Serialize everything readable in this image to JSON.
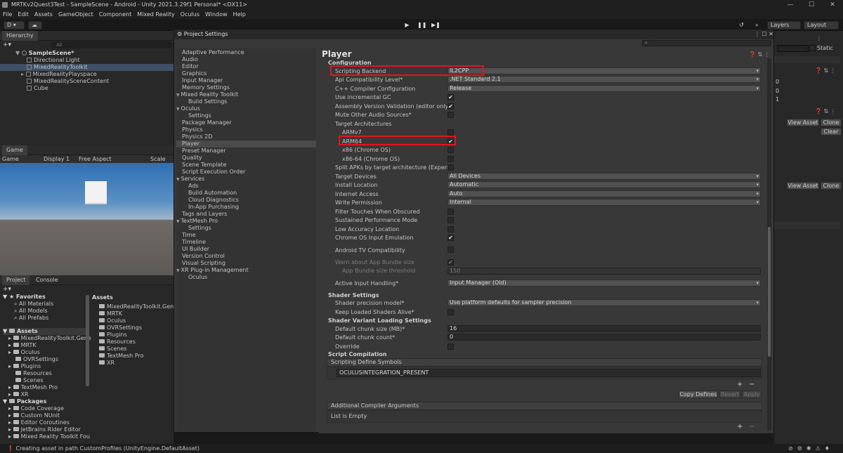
{
  "window": {
    "title": "MRTKv2Quest3Test - SampleScene - Android - Unity 2021.3.29f1 Personal* <DX11>",
    "controls": [
      "—",
      "☐",
      "✕"
    ]
  },
  "menu": [
    "File",
    "Edit",
    "Assets",
    "GameObject",
    "Component",
    "Mixed Reality",
    "Oculus",
    "Window",
    "Help"
  ],
  "toolbar": {
    "account": "D ▾",
    "cloud": "☁",
    "layers": "Layers",
    "layout": "Layout",
    "play": "▶",
    "pause": "❚❚",
    "step": "▶❚"
  },
  "hierarchy": {
    "tab": "Hierarchy",
    "search_placeholder": "All",
    "scene": "SampleScene*",
    "items": [
      "Directional Light",
      "MixedRealityToolkit",
      "MixedRealityPlayspace",
      "MixedRealitySceneContent",
      "Cube"
    ]
  },
  "game": {
    "tab": "Game",
    "mode": "Game",
    "display": "Display 1",
    "aspect": "Free Aspect",
    "scale": "Scale"
  },
  "project": {
    "tabs": [
      "Project",
      "Console"
    ],
    "favorites_label": "Favorites",
    "favorites": [
      "All Materials",
      "All Models",
      "All Prefabs"
    ],
    "assets_label": "Assets",
    "assets_tree": [
      "MixedRealityToolkit.Gene",
      "MRTK",
      "Oculus",
      "OVRSettings",
      "Plugins",
      "Resources",
      "Scenes",
      "TextMesh Pro",
      "XR"
    ],
    "packages_label": "Packages",
    "packages": [
      "Code Coverage",
      "Custom NUnit",
      "Editor Coroutines",
      "JetBrains Rider Editor",
      "Mixed Reality Toolkit Fou",
      "Mixed Reality Toolkit Fo"
    ],
    "assets_header": "Assets",
    "assets_list": [
      "MixedRealityToolkit.Genera",
      "MRTK",
      "Oculus",
      "OVRSettings",
      "Plugins",
      "Resources",
      "Scenes",
      "TextMesh Pro",
      "XR"
    ]
  },
  "project_settings": {
    "title": "Project Settings",
    "categories": [
      {
        "label": "Adaptive Performance",
        "indent": 0
      },
      {
        "label": "Audio",
        "indent": 0
      },
      {
        "label": "Editor",
        "indent": 0
      },
      {
        "label": "Graphics",
        "indent": 0
      },
      {
        "label": "Input Manager",
        "indent": 0
      },
      {
        "label": "Memory Settings",
        "indent": 0
      },
      {
        "label": "Mixed Reality Toolkit",
        "indent": 0,
        "fold": "▼"
      },
      {
        "label": "Build Settings",
        "indent": 1
      },
      {
        "label": "Oculus",
        "indent": 0,
        "fold": "▼"
      },
      {
        "label": "Settings",
        "indent": 1
      },
      {
        "label": "Package Manager",
        "indent": 0
      },
      {
        "label": "Physics",
        "indent": 0
      },
      {
        "label": "Physics 2D",
        "indent": 0
      },
      {
        "label": "Player",
        "indent": 0,
        "selected": true
      },
      {
        "label": "Preset Manager",
        "indent": 0
      },
      {
        "label": "Quality",
        "indent": 0
      },
      {
        "label": "Scene Template",
        "indent": 0
      },
      {
        "label": "Script Execution Order",
        "indent": 0
      },
      {
        "label": "Services",
        "indent": 0,
        "fold": "▼"
      },
      {
        "label": "Ads",
        "indent": 1
      },
      {
        "label": "Build Automation",
        "indent": 1
      },
      {
        "label": "Cloud Diagnostics",
        "indent": 1
      },
      {
        "label": "In-App Purchasing",
        "indent": 1
      },
      {
        "label": "Tags and Layers",
        "indent": 0
      },
      {
        "label": "TextMesh Pro",
        "indent": 0,
        "fold": "▼"
      },
      {
        "label": "Settings",
        "indent": 1
      },
      {
        "label": "Time",
        "indent": 0
      },
      {
        "label": "Timeline",
        "indent": 0
      },
      {
        "label": "UI Builder",
        "indent": 0
      },
      {
        "label": "Version Control",
        "indent": 0
      },
      {
        "label": "Visual Scripting",
        "indent": 0
      },
      {
        "label": "XR Plug-in Management",
        "indent": 0,
        "fold": "▼"
      },
      {
        "label": "Oculus",
        "indent": 1
      }
    ],
    "player": {
      "heading": "Player",
      "configuration": "Configuration",
      "scripting_backend": {
        "label": "Scripting Backend",
        "value": "IL2CPP"
      },
      "api_level": {
        "label": "Api Compatibility Level*",
        "value": ".NET Standard 2.1"
      },
      "cpp_config": {
        "label": "C++ Compiler Configuration",
        "value": "Release"
      },
      "incremental_gc": {
        "label": "Use incremental GC",
        "checked": "✔"
      },
      "assembly_validation": {
        "label": "Assembly Version Validation (editor only)",
        "checked": "✔"
      },
      "mute_audio": {
        "label": "Mute Other Audio Sources*",
        "checked": ""
      },
      "target_arch": "Target Architectures",
      "armv7": {
        "label": "ARMv7",
        "checked": ""
      },
      "arm64": {
        "label": "ARM64",
        "checked": "✔"
      },
      "x86": {
        "label": "x86 (Chrome OS)",
        "checked": ""
      },
      "x86_64": {
        "label": "x86-64 (Chrome OS)",
        "checked": ""
      },
      "split_apks": {
        "label": "Split APKs by target architecture (Experimenta",
        "checked": ""
      },
      "target_devices": {
        "label": "Target Devices",
        "value": "All Devices"
      },
      "install_location": {
        "label": "Install Location",
        "value": "Automatic"
      },
      "internet_access": {
        "label": "Internet Access",
        "value": "Auto"
      },
      "write_permission": {
        "label": "Write Permission",
        "value": "Internal"
      },
      "filter_touches": {
        "label": "Filter Touches When Obscured",
        "checked": ""
      },
      "sustained_perf": {
        "label": "Sustained Performance Mode",
        "checked": ""
      },
      "low_accuracy": {
        "label": "Low Accuracy Location",
        "checked": ""
      },
      "chrome_input": {
        "label": "Chrome OS Input Emulation",
        "checked": "✔"
      },
      "android_tv": {
        "label": "Android TV Compatibility",
        "checked": ""
      },
      "warn_bundle": {
        "label": "Warn about App Bundle size",
        "checked": "✔"
      },
      "bundle_threshold": {
        "label": "App Bundle size threshold",
        "value": "150"
      },
      "active_input": {
        "label": "Active Input Handling*",
        "value": "Input Manager (Old)"
      },
      "shader_settings": "Shader Settings",
      "shader_precision": {
        "label": "Shader precision model*",
        "value": "Use platform defaults for sampler precision"
      },
      "keep_shaders": {
        "label": "Keep Loaded Shaders Alive*",
        "checked": ""
      },
      "shader_variant": "Shader Variant Loading Settings",
      "chunk_size": {
        "label": "Default chunk size (MB)*",
        "value": "16"
      },
      "chunk_count": {
        "label": "Default chunk count*",
        "value": "0"
      },
      "override": {
        "label": "Override",
        "checked": ""
      },
      "script_compilation": "Script Compilation",
      "define_symbols": {
        "label": "Scripting Define Symbols",
        "value": "OCULUSINTEGRATION_PRESENT"
      },
      "plus": "+",
      "minus": "−",
      "copy_defines": "Copy Defines",
      "revert": "Revert",
      "apply": "Apply",
      "compiler_args": {
        "label": "Additional Compiler Arguments",
        "empty": "List is Empty"
      }
    }
  },
  "inspector": {
    "static": "Static",
    "view_asset": "View Asset",
    "clone": "Clone",
    "clear": "Clear",
    "values": [
      "0",
      "0",
      "1"
    ]
  },
  "status": {
    "message": "Creating asset in path CustomProfiles (UnityEngine.DefaultAsset)"
  }
}
